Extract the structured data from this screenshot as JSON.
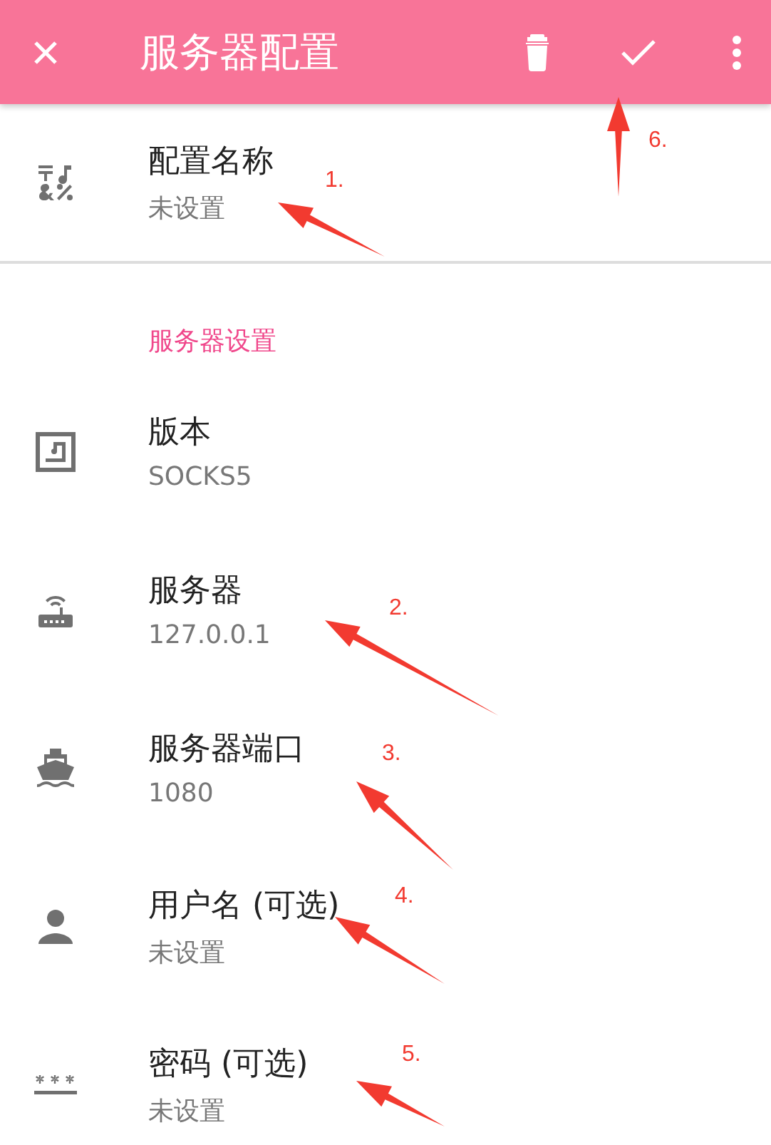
{
  "app_bar": {
    "title": "服务器配置"
  },
  "profile_item": {
    "kind": "name",
    "title": "配置名称",
    "summary": "未设置"
  },
  "section": {
    "header": "服务器设置"
  },
  "items": [
    {
      "kind": "version",
      "title": "版本",
      "summary": "SOCKS5"
    },
    {
      "kind": "server",
      "title": "服务器",
      "summary": "127.0.0.1"
    },
    {
      "kind": "port",
      "title": "服务器端口",
      "summary": "1080"
    },
    {
      "kind": "user",
      "title": "用户名 (可选)",
      "summary": "未设置"
    },
    {
      "kind": "password",
      "title": "密码 (可选)",
      "summary": "未设置"
    }
  ],
  "annotations": [
    {
      "label": "1."
    },
    {
      "label": "6."
    },
    {
      "label": "2."
    },
    {
      "label": "3."
    },
    {
      "label": "4."
    },
    {
      "label": "5."
    }
  ]
}
